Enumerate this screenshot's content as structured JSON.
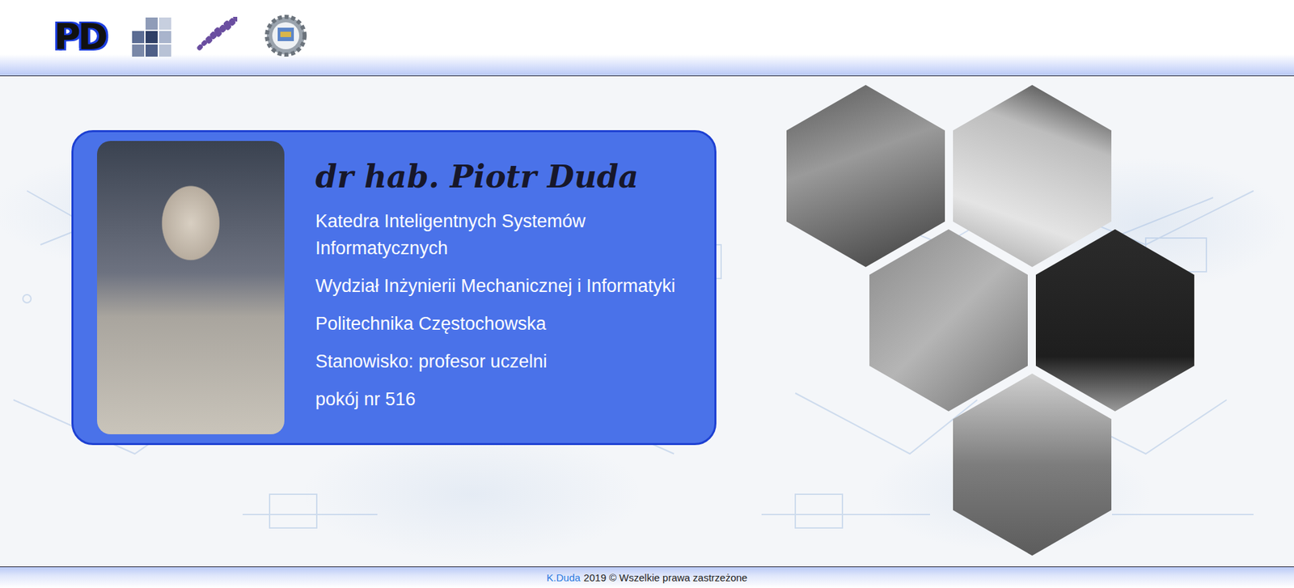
{
  "header": {
    "logos": [
      {
        "kind": "text",
        "text": "PD"
      },
      {
        "kind": "grid"
      },
      {
        "kind": "chain"
      },
      {
        "kind": "emblem"
      }
    ]
  },
  "card": {
    "name": "dr hab. Piotr Duda",
    "lines": [
      "Katedra Inteligentnych Systemów Informatycznych",
      "Wydział Inżynierii Mechanicznej i Informatyki",
      "Politechnika Częstochowska",
      "Stanowisko: profesor uczelni",
      "pokój nr 516"
    ]
  },
  "footer": {
    "author": "K.Duda",
    "text": "2019 © Wszelkie prawa zastrzeżone"
  }
}
